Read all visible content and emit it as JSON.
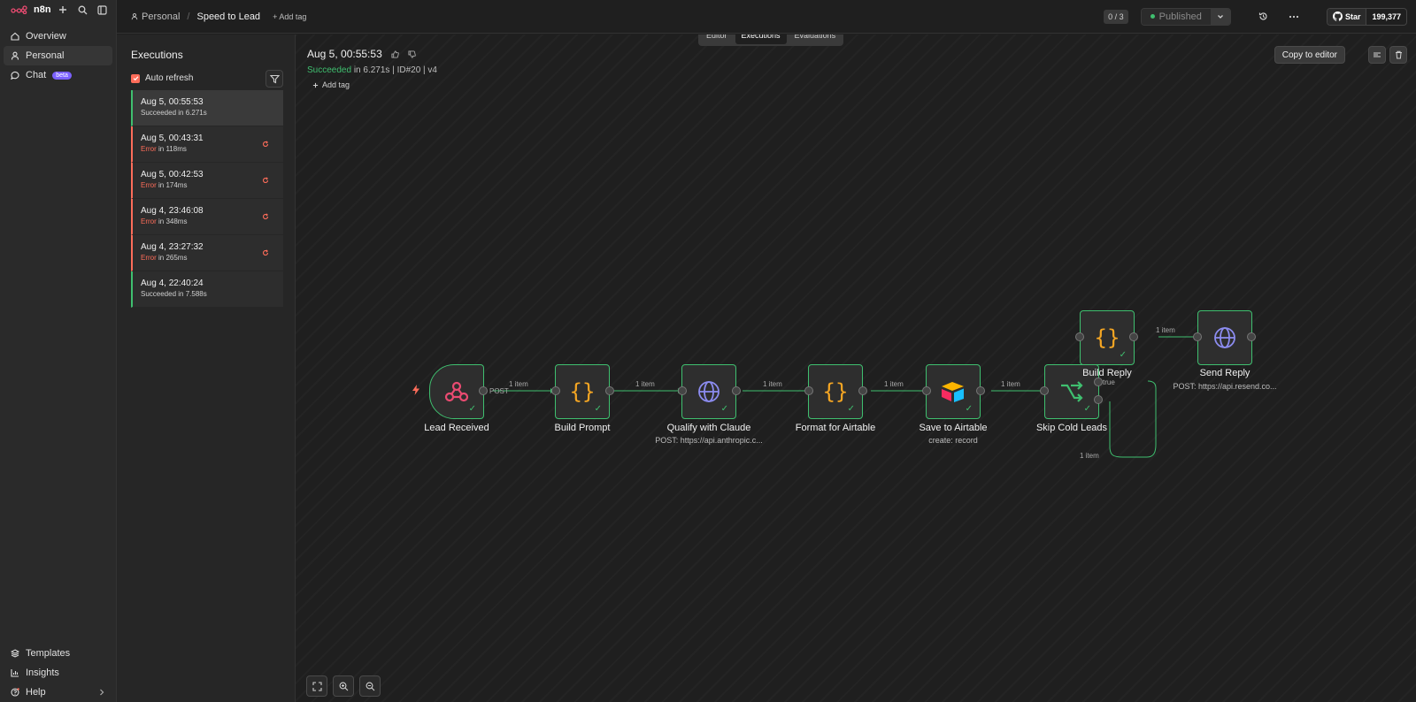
{
  "app": {
    "name": "n8n"
  },
  "sidebar": {
    "nav": [
      {
        "label": "Overview",
        "icon": "home-icon"
      },
      {
        "label": "Personal",
        "icon": "user-icon"
      },
      {
        "label": "Chat",
        "icon": "chat-icon",
        "badge": "beta"
      }
    ],
    "bottom": [
      {
        "label": "Templates",
        "icon": "templates-icon"
      },
      {
        "label": "Insights",
        "icon": "chart-icon"
      },
      {
        "label": "Help",
        "icon": "help-icon"
      }
    ]
  },
  "header": {
    "breadcrumb_project": "Personal",
    "breadcrumb_sep": "/",
    "workflow_name": "Speed to Lead",
    "add_tag": "+ Add tag",
    "counter": "0 / 3",
    "published_label": "Published",
    "github_star": "Star",
    "github_count": "199,377"
  },
  "executions": {
    "title": "Executions",
    "auto_refresh_label": "Auto refresh",
    "items": [
      {
        "date": "Aug 5, 00:55:53",
        "status": "Succeeded",
        "detail": " in 6.271s",
        "state": "success",
        "selected": true
      },
      {
        "date": "Aug 5, 00:43:31",
        "status": "Error",
        "detail": " in 118ms",
        "state": "error"
      },
      {
        "date": "Aug 5, 00:42:53",
        "status": "Error",
        "detail": " in 174ms",
        "state": "error"
      },
      {
        "date": "Aug 4, 23:46:08",
        "status": "Error",
        "detail": " in 348ms",
        "state": "error"
      },
      {
        "date": "Aug 4, 23:27:32",
        "status": "Error",
        "detail": " in 265ms",
        "state": "error"
      },
      {
        "date": "Aug 4, 22:40:24",
        "status": "Succeeded",
        "detail": " in 7.588s",
        "state": "success"
      }
    ]
  },
  "canvas": {
    "tabs": [
      {
        "label": "Editor",
        "active": false
      },
      {
        "label": "Executions",
        "active": true
      },
      {
        "label": "Evaluations",
        "active": false
      }
    ],
    "exec_title": "Aug 5, 00:55:53",
    "exec_status": "Succeeded",
    "exec_meta": " in 6.271s | ID#20 | v4",
    "add_tag": "Add tag",
    "copy_to_editor": "Copy to editor"
  },
  "workflow": {
    "nodes": [
      {
        "id": "lead",
        "label": "Lead Received",
        "sub": "",
        "icon": "webhook-icon"
      },
      {
        "id": "prompt",
        "label": "Build Prompt",
        "sub": "",
        "icon": "code-braces-icon"
      },
      {
        "id": "claude",
        "label": "Qualify with Claude",
        "sub": "POST: https://api.anthropic.c...",
        "icon": "globe-icon"
      },
      {
        "id": "format",
        "label": "Format for Airtable",
        "sub": "",
        "icon": "code-braces-icon"
      },
      {
        "id": "airtable",
        "label": "Save to Airtable",
        "sub": "create: record",
        "icon": "airtable-icon"
      },
      {
        "id": "skip",
        "label": "Skip Cold Leads",
        "sub": "",
        "icon": "if-branch-icon"
      },
      {
        "id": "reply",
        "label": "Build Reply",
        "sub": "",
        "icon": "code-braces-icon"
      },
      {
        "id": "send",
        "label": "Send Reply",
        "sub": "POST: https://api.resend.co...",
        "icon": "globe-icon"
      }
    ],
    "edge_labels": {
      "post": "POST",
      "item": "1 item",
      "true": "true"
    }
  },
  "colors": {
    "success": "#3fbf6f",
    "error": "#ff6d5a",
    "accent_code": "#f5a623",
    "globe": "#8c8cf0"
  }
}
